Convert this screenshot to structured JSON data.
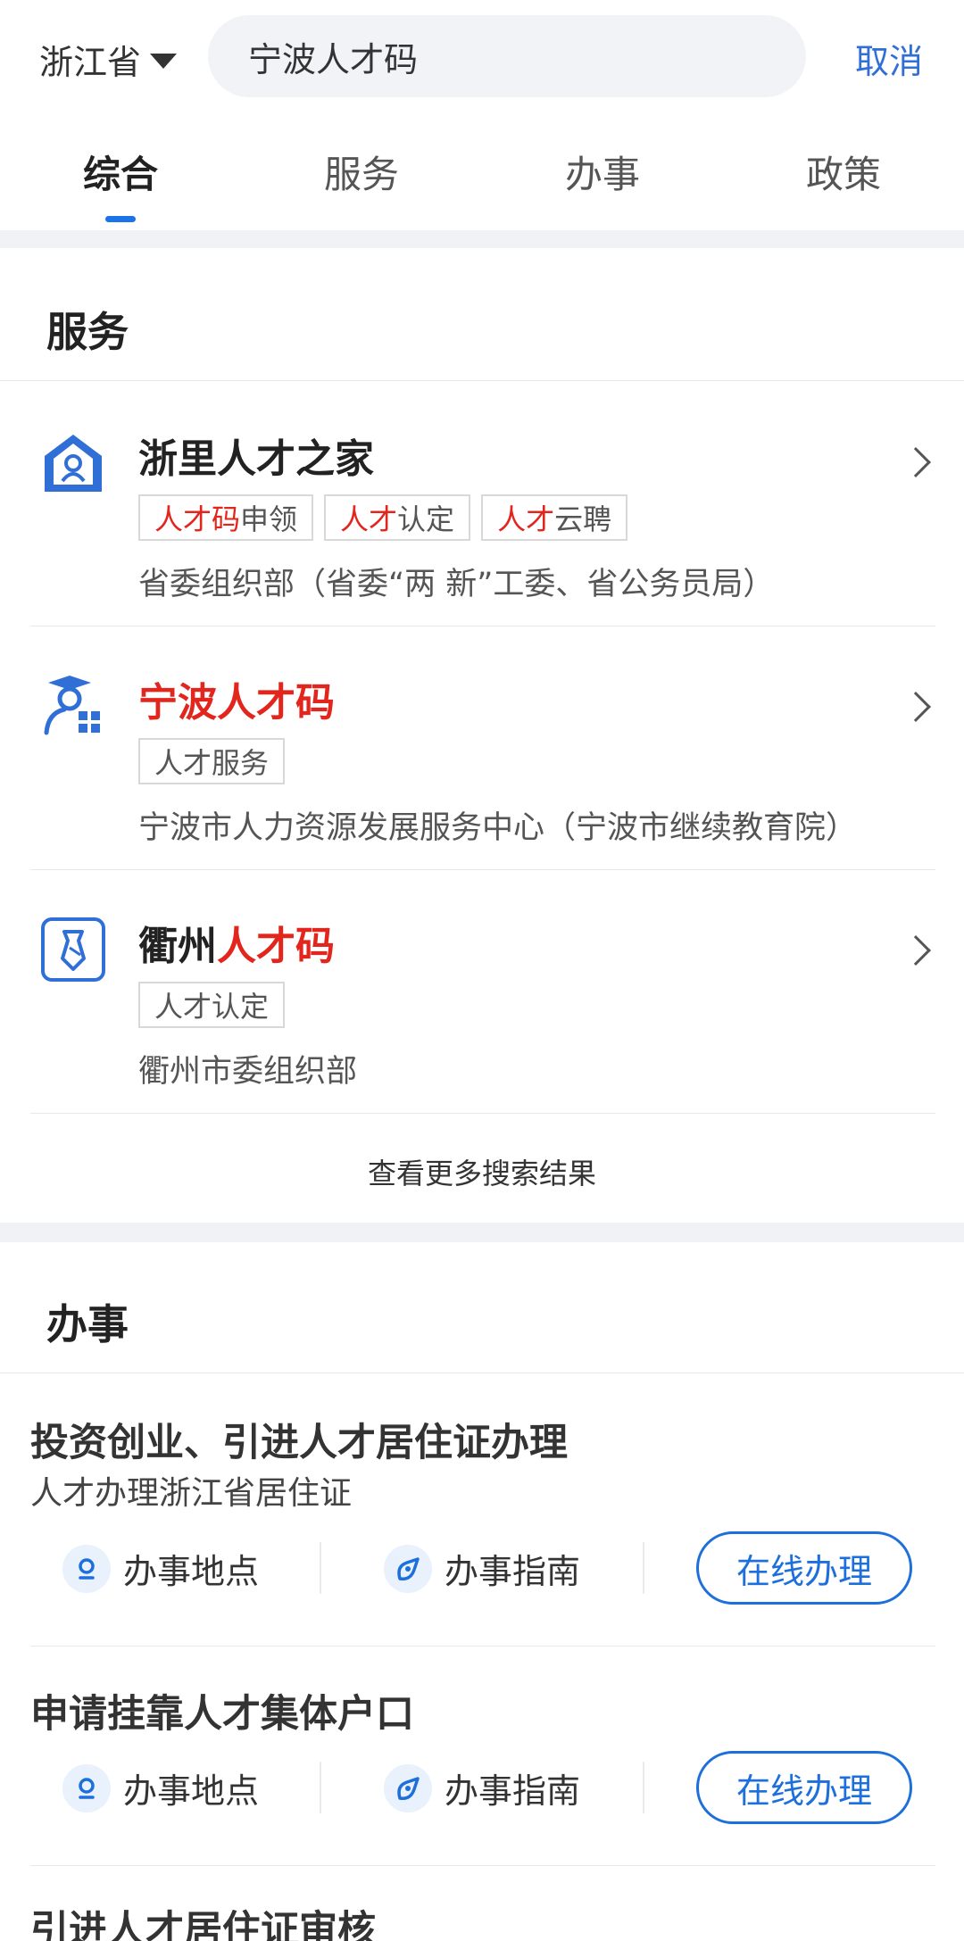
{
  "header": {
    "region": "浙江省",
    "search_value": "宁波人才码",
    "cancel_label": "取消"
  },
  "tabs": [
    {
      "label": "综合",
      "active": true
    },
    {
      "label": "服务",
      "active": false
    },
    {
      "label": "办事",
      "active": false
    },
    {
      "label": "政策",
      "active": false
    }
  ],
  "services": {
    "title": "服务",
    "items": [
      {
        "title": "浙里人才之家",
        "icon": "talent-home-icon",
        "tags": [
          {
            "hl": "人才码",
            "rest": "申领"
          },
          {
            "hl": "人才",
            "rest": "认定"
          },
          {
            "hl": "人才",
            "rest": "云聘"
          }
        ],
        "org": "省委组织部（省委“两 新”工委、省公务员局）"
      },
      {
        "title_hl": "宁波人才码",
        "icon": "graduate-qr-icon",
        "tags": [
          {
            "hl": "",
            "rest": "人才服务"
          }
        ],
        "org": "宁波市人力资源发展服务中心（宁波市继续教育院）"
      },
      {
        "title_plain": "衢州",
        "title_hl": "人才码",
        "icon": "tie-badge-icon",
        "tags": [
          {
            "hl": "",
            "rest": "人才认定"
          }
        ],
        "org": "衢州市委组织部"
      }
    ],
    "more_label": "查看更多搜索结果"
  },
  "affairs": {
    "title": "办事",
    "items": [
      {
        "title": "投资创业、引进人才居住证办理",
        "subtitle": "人才办理浙江省居住证",
        "location_label": "办事地点",
        "guide_label": "办事指南",
        "online_label": "在线办理"
      },
      {
        "title": "申请挂靠人才集体户口",
        "location_label": "办事地点",
        "guide_label": "办事指南",
        "online_label": "在线办理"
      },
      {
        "title": "引进人才居住证审核"
      }
    ]
  },
  "colors": {
    "accent": "#1a73e8",
    "highlight": "#e2261d",
    "separator_band": "#f0f2f5"
  }
}
